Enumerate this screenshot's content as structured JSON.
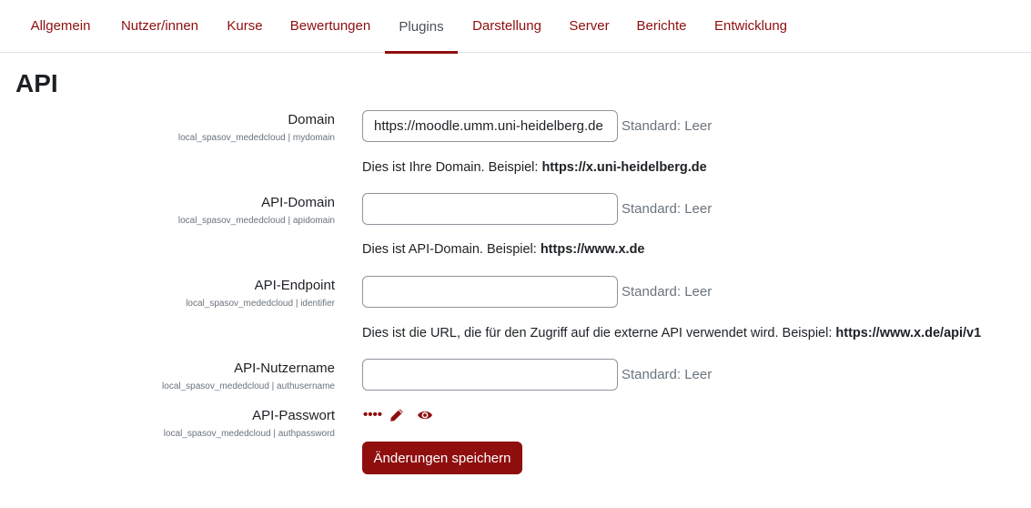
{
  "tabs": [
    {
      "label": "Allgemein",
      "active": false
    },
    {
      "label": "Nutzer/innen",
      "active": false
    },
    {
      "label": "Kurse",
      "active": false
    },
    {
      "label": "Bewertungen",
      "active": false
    },
    {
      "label": "Plugins",
      "active": true
    },
    {
      "label": "Darstellung",
      "active": false
    },
    {
      "label": "Server",
      "active": false
    },
    {
      "label": "Berichte",
      "active": false
    },
    {
      "label": "Entwicklung",
      "active": false
    }
  ],
  "page_title": "API",
  "settings": [
    {
      "label": "Domain",
      "key": "local_spasov_mededcloud | mydomain",
      "value": "https://moodle.umm.uni-heidelberg.de",
      "default": "Standard: Leer",
      "desc_text": "Dies ist Ihre Domain. Beispiel: ",
      "desc_bold": "https://x.uni-heidelberg.de"
    },
    {
      "label": "API-Domain",
      "key": "local_spasov_mededcloud | apidomain",
      "value": "",
      "default": "Standard: Leer",
      "desc_text": "Dies ist API-Domain. Beispiel: ",
      "desc_bold": "https://www.x.de"
    },
    {
      "label": "API-Endpoint",
      "key": "local_spasov_mededcloud | identifier",
      "value": "",
      "default": "Standard: Leer",
      "desc_text": "Dies ist die URL, die für den Zugriff auf die externe API verwendet wird. Beispiel: ",
      "desc_bold": "https://www.x.de/api/v1"
    },
    {
      "label": "API-Nutzername",
      "key": "local_spasov_mededcloud | authusername",
      "value": "",
      "default": "Standard: Leer"
    },
    {
      "label": "API-Passwort",
      "key": "local_spasov_mededcloud | authpassword",
      "masked_value": "••••"
    }
  ],
  "icons": {
    "edit": "pencil-icon",
    "reveal": "eye-icon"
  },
  "save_button": "Änderungen speichern",
  "colors": {
    "accent": "#8f0e0e",
    "muted": "#6a737b",
    "text": "#1d2125"
  }
}
